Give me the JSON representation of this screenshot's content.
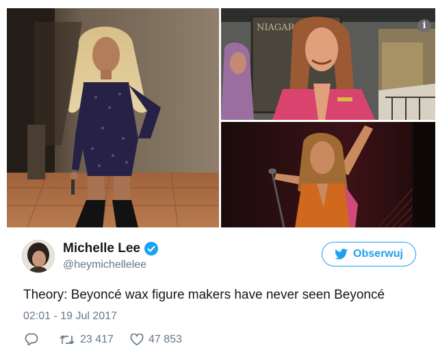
{
  "tweet": {
    "author_name": "Michelle Lee",
    "handle": "@heymichellelee",
    "follow_label": "Obserwuj",
    "text": "Theory: Beyoncé wax figure makers have never seen Beyoncé",
    "timestamp": "02:01 - 19 Jul 2017",
    "retweets": "23 417",
    "likes": "47 853",
    "sign_text": "NIAGARA SW"
  },
  "colors": {
    "accent": "#1da1f2",
    "text": "#14171a",
    "muted": "#657786"
  },
  "icons": [
    "info-icon",
    "verified-badge-icon",
    "twitter-bird-icon",
    "reply-icon",
    "retweet-icon",
    "like-icon"
  ]
}
